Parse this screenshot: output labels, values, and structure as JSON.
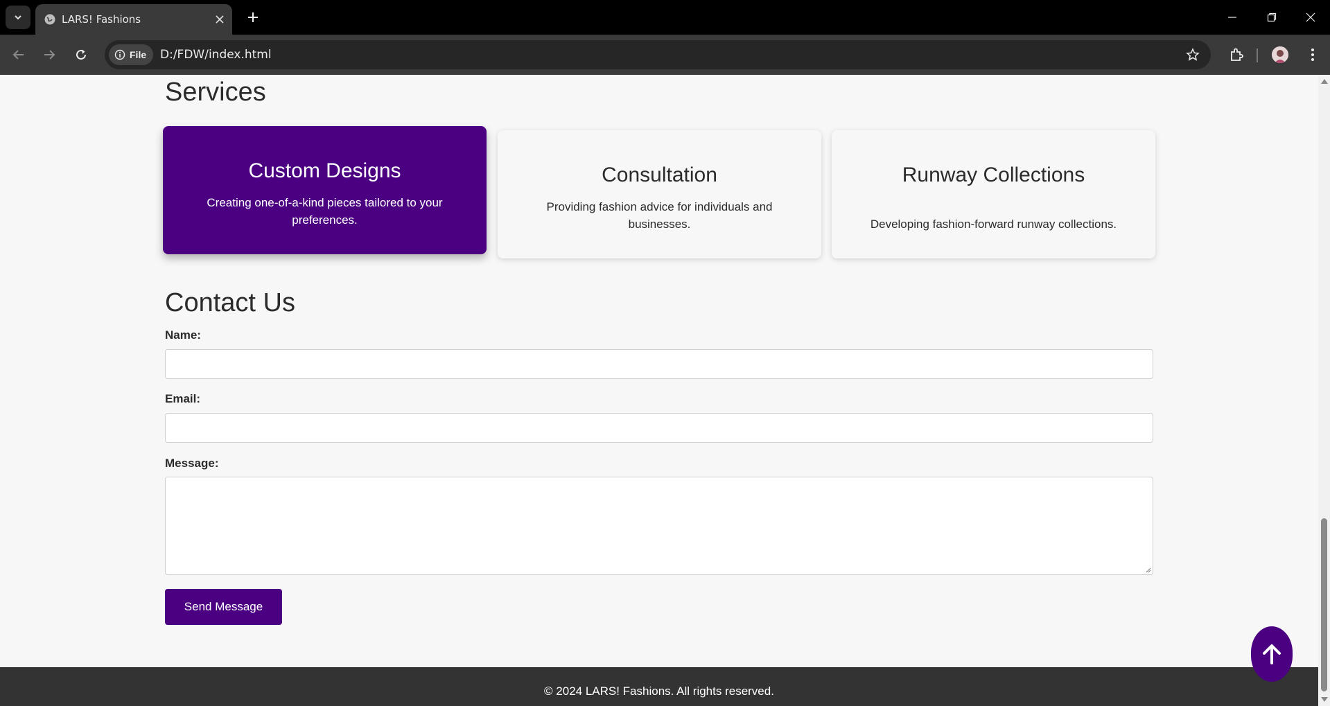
{
  "browser": {
    "tab_title": "LARS! Fashions",
    "site_chip": "File",
    "url": "D:/FDW/index.html",
    "icons": [
      "tab-list-icon",
      "globe-icon",
      "close-icon",
      "plus-icon",
      "minimize-icon",
      "restore-icon",
      "close-window-icon",
      "back-icon",
      "forward-icon",
      "reload-icon",
      "info-icon",
      "star-icon",
      "extensions-icon",
      "avatar",
      "more-icon"
    ]
  },
  "services": {
    "title": "Services",
    "cards": [
      {
        "title": "Custom Designs",
        "text": "Creating one-of-a-kind pieces tailored to your preferences."
      },
      {
        "title": "Consultation",
        "text": "Providing fashion advice for individuals and businesses."
      },
      {
        "title": "Runway Collections",
        "text": "Developing fashion-forward runway collections."
      }
    ]
  },
  "contact": {
    "title": "Contact Us",
    "name_label": "Name:",
    "name_value": "",
    "email_label": "Email:",
    "email_value": "",
    "message_label": "Message:",
    "message_value": "",
    "send_label": "Send Message"
  },
  "footer": {
    "text": "© 2024 LARS! Fashions. All rights reserved."
  },
  "colors": {
    "accent": "#4b0082",
    "footer_bg": "#333333",
    "page_bg": "#f7f7f7"
  }
}
